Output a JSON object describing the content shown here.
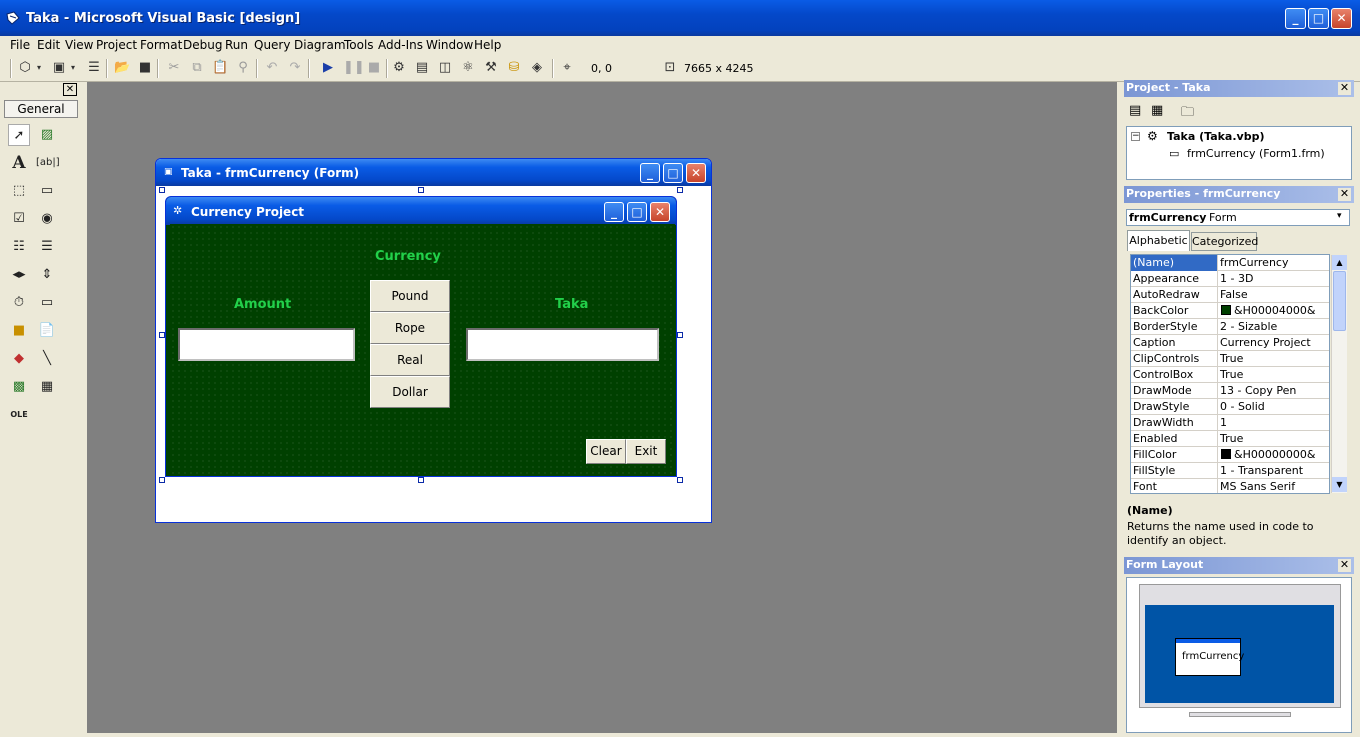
{
  "window": {
    "title": "Taka - Microsoft Visual Basic [design]",
    "min": "_",
    "max": "□",
    "close": "✕"
  },
  "menu": [
    "File",
    "Edit",
    "View",
    "Project",
    "Format",
    "Debug",
    "Run",
    "Query",
    "Diagram",
    "Tools",
    "Add-Ins",
    "Window",
    "Help"
  ],
  "toolbar": {
    "position": "0, 0",
    "size": "7665 x 4245"
  },
  "toolbox": {
    "tab_label": "General",
    "close": "✕"
  },
  "designer": {
    "title": "Taka - frmCurrency (Form)"
  },
  "form": {
    "caption": "Currency Project",
    "currency_label": "Currency",
    "amount_label": "Amount",
    "taka_label": "Taka",
    "amount_value": "",
    "taka_value": "",
    "buttons": [
      "Pound",
      "Rope",
      "Real",
      "Dollar"
    ],
    "clear_label": "Clear",
    "exit_label": "Exit"
  },
  "project": {
    "title": "Project - Taka",
    "root": "Taka (Taka.vbp)",
    "form": "frmCurrency (Form1.frm)"
  },
  "properties": {
    "title": "Properties - frmCurrency",
    "object_name": "frmCurrency",
    "object_type": "Form",
    "tab_alpha": "Alphabetic",
    "tab_cat": "Categorized",
    "rows": [
      {
        "name": "(Name)",
        "value": "frmCurrency"
      },
      {
        "name": "Appearance",
        "value": "1 - 3D"
      },
      {
        "name": "AutoRedraw",
        "value": "False"
      },
      {
        "name": "BackColor",
        "value": "&H00004000&",
        "swatch": "#004000"
      },
      {
        "name": "BorderStyle",
        "value": "2 - Sizable"
      },
      {
        "name": "Caption",
        "value": "Currency Project"
      },
      {
        "name": "ClipControls",
        "value": "True"
      },
      {
        "name": "ControlBox",
        "value": "True"
      },
      {
        "name": "DrawMode",
        "value": "13 - Copy Pen"
      },
      {
        "name": "DrawStyle",
        "value": "0 - Solid"
      },
      {
        "name": "DrawWidth",
        "value": "1"
      },
      {
        "name": "Enabled",
        "value": "True"
      },
      {
        "name": "FillColor",
        "value": "&H00000000&",
        "swatch": "#000000"
      },
      {
        "name": "FillStyle",
        "value": "1 - Transparent"
      },
      {
        "name": "Font",
        "value": "MS Sans Serif"
      }
    ],
    "desc_title": "(Name)",
    "desc_text": "Returns the name used in code to identify an object."
  },
  "layout": {
    "title": "Form Layout",
    "form_label": "frmCurrency"
  },
  "colors": {
    "form_bg": "#004000",
    "label_green": "#22d04a",
    "selected_row": "#316ac5",
    "layout_screen": "#0054a6"
  }
}
